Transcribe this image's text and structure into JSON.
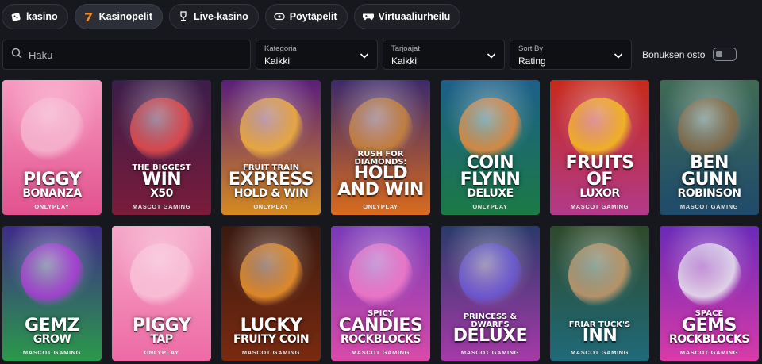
{
  "tabs": [
    {
      "label": "kasino",
      "icon": "dice-icon",
      "active": false
    },
    {
      "label": "Kasinopelit",
      "icon": "seven-icon",
      "active": true
    },
    {
      "label": "Live-kasino",
      "icon": "trophy-icon",
      "active": false
    },
    {
      "label": "Pöytäpelit",
      "icon": "chips-icon",
      "active": false
    },
    {
      "label": "Virtuaaliurheilu",
      "icon": "gamepad-icon",
      "active": false
    }
  ],
  "filters": {
    "search_placeholder": "Haku",
    "category": {
      "label": "Kategoria",
      "value": "Kaikki"
    },
    "providers": {
      "label": "Tarjoajat",
      "value": "Kaikki"
    },
    "sort": {
      "label": "Sort By",
      "value": "Rating"
    },
    "bonus_buy": {
      "label": "Bonuksen osto",
      "checked": false
    }
  },
  "games": [
    {
      "pre": "",
      "main": "PIGGY",
      "sub": "BONANZA",
      "provider": "ONLYPLAY",
      "bg": [
        "#f79ac0",
        "#e2528f"
      ],
      "art": "#f6b6cf"
    },
    {
      "pre": "THE BIGGEST",
      "main": "WIN",
      "sub": "X50",
      "provider": "MASCOT GAMING",
      "bg": [
        "#3b1d4a",
        "#7a1c3a"
      ],
      "art": "#e94b4b"
    },
    {
      "pre": "FRUIT TRAIN",
      "main": "EXPRESS",
      "sub": "HOLD & WIN",
      "provider": "ONLYPLAY",
      "bg": [
        "#5a1f7a",
        "#d68a1f"
      ],
      "art": "#f2b23a"
    },
    {
      "pre": "RUSH FOR DIAMONDS:",
      "main": "HOLD AND WIN",
      "sub": "",
      "provider": "ONLYPLAY",
      "bg": [
        "#3d2a6b",
        "#d96b1e"
      ],
      "art": "#c9843a"
    },
    {
      "pre": "",
      "main": "COIN FLYNN",
      "sub": "DELUXE",
      "provider": "ONLYPLAY",
      "bg": [
        "#1d5f8a",
        "#1b7a45"
      ],
      "art": "#f08a3a"
    },
    {
      "pre": "",
      "main": "FRUITS OF",
      "sub": "LUXOR",
      "provider": "MASCOT GAMING",
      "bg": [
        "#c72a1b",
        "#b23a8a"
      ],
      "art": "#f6c21c"
    },
    {
      "pre": "",
      "main": "BEN GUNN",
      "sub": "ROBINSON",
      "provider": "MASCOT GAMING",
      "bg": [
        "#3f6b55",
        "#1f4a6b"
      ],
      "art": "#8a6a45"
    },
    {
      "pre": "",
      "main": "GEMZ",
      "sub": "GROW",
      "provider": "MASCOT GAMING",
      "bg": [
        "#3f2a8a",
        "#2a9a4a"
      ],
      "art": "#b03adb"
    },
    {
      "pre": "",
      "main": "PIGGY",
      "sub": "TAP",
      "provider": "ONLYPLAY",
      "bg": [
        "#f5a8c8",
        "#ee6aa5"
      ],
      "art": "#f9c3d8"
    },
    {
      "pre": "",
      "main": "LUCKY",
      "sub": "FRUITY COIN",
      "provider": "MASCOT GAMING",
      "bg": [
        "#3a1a10",
        "#7a2a10"
      ],
      "art": "#f0962a"
    },
    {
      "pre": "SPICY",
      "main": "CANDIES",
      "sub": "ROCKBLOCKS",
      "provider": "MASCOT GAMING",
      "bg": [
        "#7a3ab8",
        "#d94aa8"
      ],
      "art": "#f27ac8"
    },
    {
      "pre": "PRINCESS & DWARFS",
      "main": "DELUXE",
      "sub": "",
      "provider": "MASCOT GAMING",
      "bg": [
        "#2a3a6b",
        "#a63aa8"
      ],
      "art": "#6a5ad8"
    },
    {
      "pre": "FRIAR TUCK'S",
      "main": "INN",
      "sub": "",
      "provider": "MASCOT GAMING",
      "bg": [
        "#2f4a2a",
        "#1f6a7a"
      ],
      "art": "#c99a6a"
    },
    {
      "pre": "SPACE",
      "main": "GEMS",
      "sub": "ROCKBLOCKS",
      "provider": "MASCOT GAMING",
      "bg": [
        "#6a2ab8",
        "#d93aa8"
      ],
      "art": "#e8e8f0"
    }
  ]
}
